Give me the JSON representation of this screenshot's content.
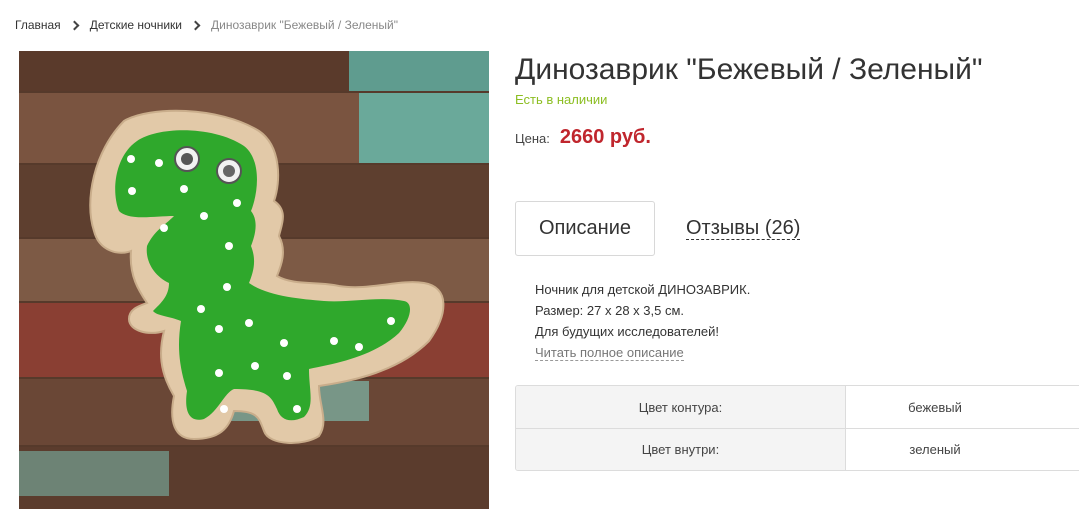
{
  "breadcrumb": {
    "home": "Главная",
    "category": "Детские ночники",
    "current": "Динозаврик \"Бежевый / Зеленый\""
  },
  "product": {
    "title": "Динозаврик \"Бежевый / Зеленый\"",
    "availability": "Есть в наличии",
    "price_label": "Цена:",
    "price": "2660 руб."
  },
  "tabs": {
    "description": "Описание",
    "reviews": "Отзывы (26)"
  },
  "description": {
    "line1": "Ночник для детской ДИНОЗАВРИК.",
    "line2": "Размер: 27 х 28 х 3,5 см.",
    "line3": "Для будущих исследователей!",
    "read_more": "Читать полное описание"
  },
  "specs": [
    {
      "name": "Цвет контура:",
      "value": "бежевый"
    },
    {
      "name": "Цвет внутри:",
      "value": "зеленый"
    }
  ],
  "colors": {
    "in_stock": "#8cbe22",
    "price": "#c0262d",
    "dino_frame": "#e2c9a8",
    "dino_fill": "#2fa82c"
  }
}
